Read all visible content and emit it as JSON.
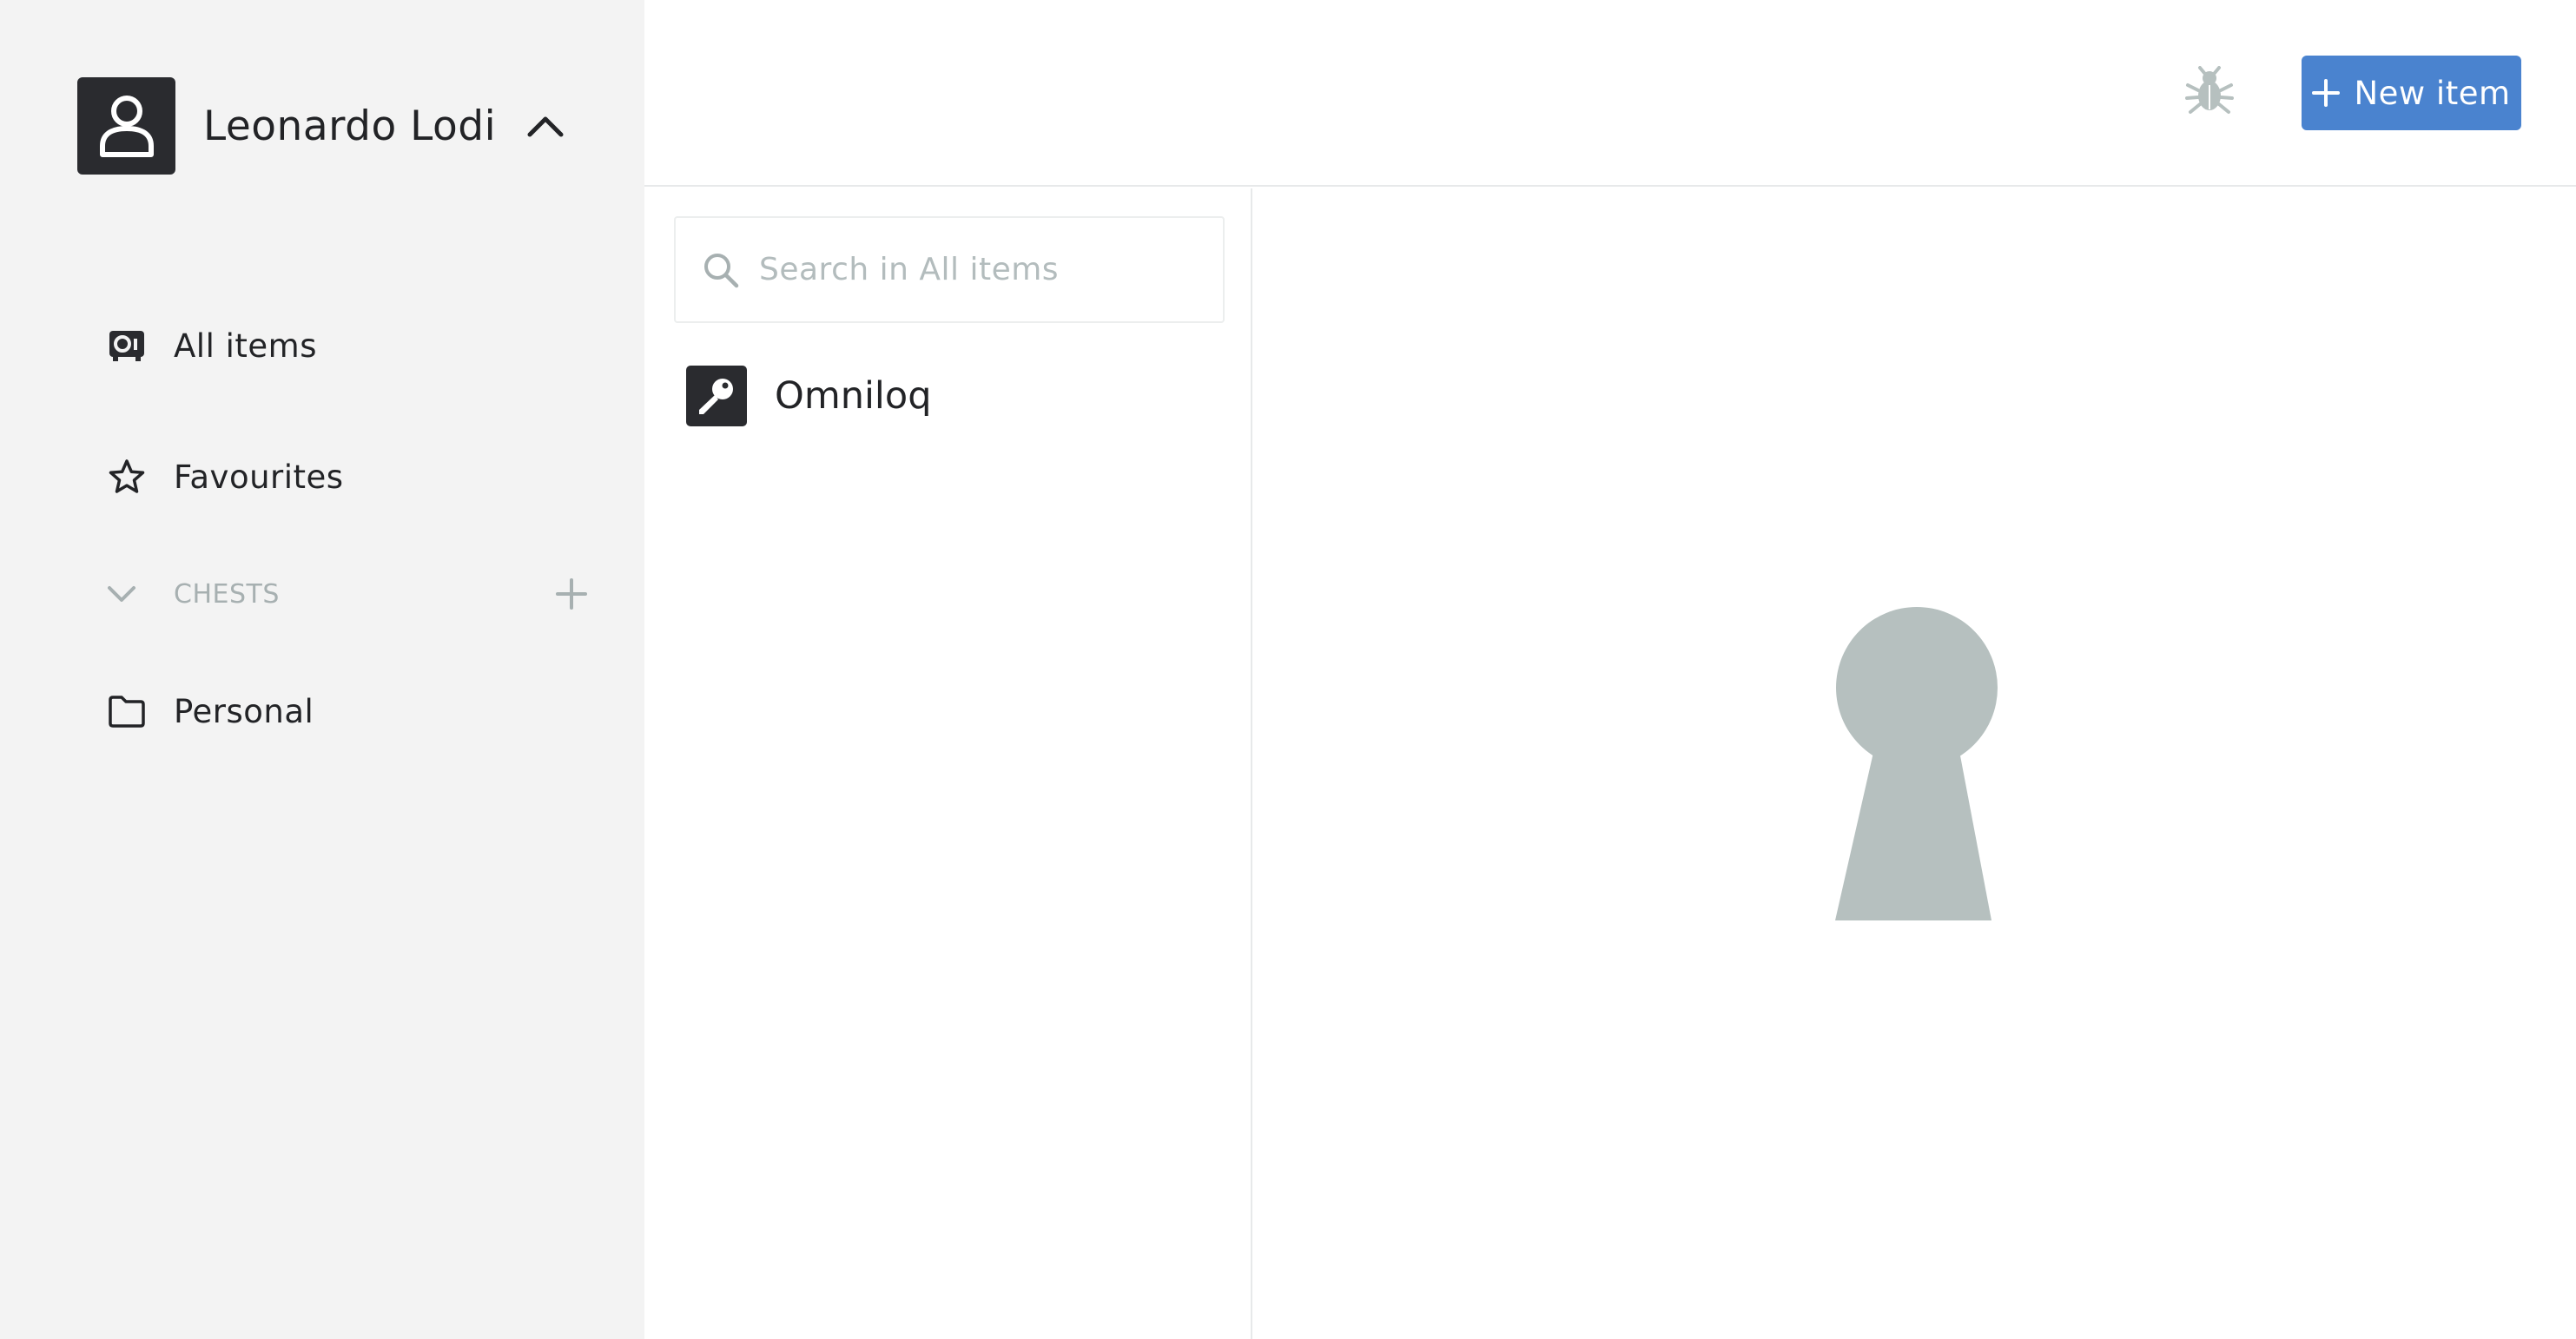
{
  "user": {
    "name": "Leonardo Lodi",
    "avatar_icon": "user-icon",
    "toggle_icon": "chevron-up-icon"
  },
  "sidebar": {
    "items": [
      {
        "label": "All items",
        "icon": "vault-icon"
      },
      {
        "label": "Favourites",
        "icon": "star-icon"
      }
    ],
    "chests_section": {
      "title": "CHESTS",
      "collapse_icon": "chevron-down-icon",
      "add_icon": "plus-icon",
      "items": [
        {
          "label": "Personal",
          "icon": "folder-icon"
        }
      ]
    }
  },
  "toolbar": {
    "bug_icon": "bug-icon",
    "new_item_label": "New item"
  },
  "search": {
    "placeholder": "Search in All items",
    "value": ""
  },
  "items_list": [
    {
      "name": "Omniloq",
      "icon": "key-icon"
    }
  ],
  "detail": {
    "empty_state_icon": "keyhole-icon"
  },
  "colors": {
    "sidebar_bg": "#f3f3f3",
    "accent": "#4a83cf",
    "icon_dark": "#2a2b2f",
    "muted": "#a7b0b1",
    "keyhole": "#b6c0bf"
  }
}
